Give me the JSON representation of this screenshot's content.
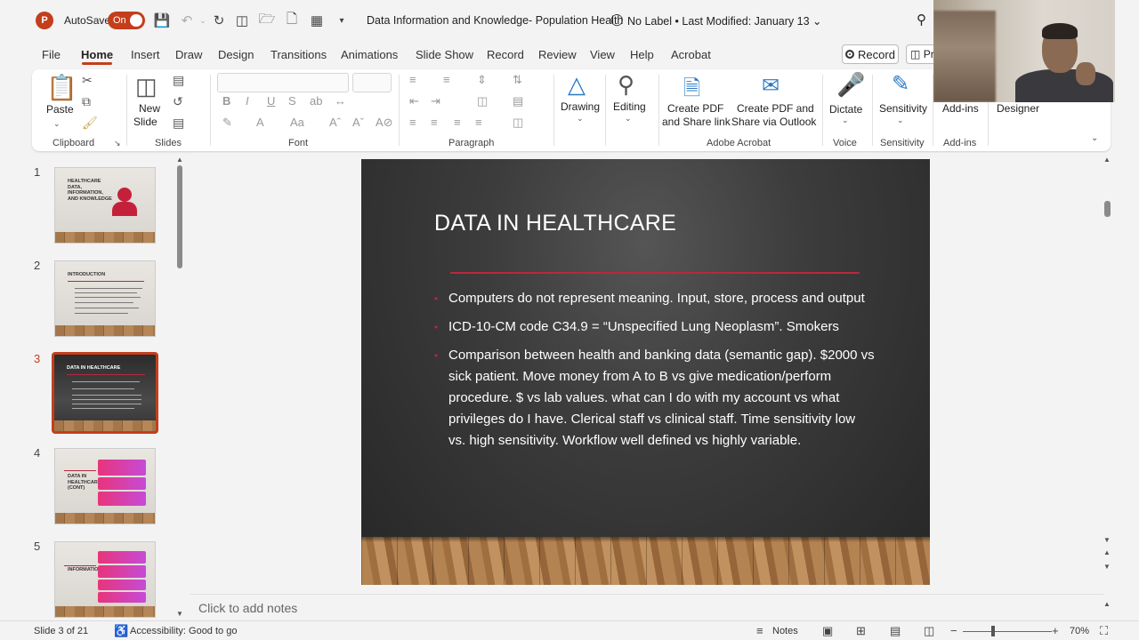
{
  "titlebar": {
    "app_letter": "P",
    "autosave_label": "AutoSave",
    "autosave_state": "On",
    "document_title": "Data Information and Knowledge- Population Health",
    "sensitivity_label": "No Label",
    "last_modified": "•  Last Modified: January 13"
  },
  "menu": {
    "items": [
      "File",
      "Home",
      "Insert",
      "Draw",
      "Design",
      "Transitions",
      "Animations",
      "Slide Show",
      "Record",
      "Review",
      "View",
      "Help",
      "Acrobat"
    ],
    "active": "Home",
    "record_label": "Record",
    "present_label": "Pr"
  },
  "ribbon": {
    "clipboard": {
      "paste": "Paste",
      "group": "Clipboard"
    },
    "slides": {
      "new_slide": "New",
      "new_slide2": "Slide",
      "group": "Slides"
    },
    "font": {
      "group": "Font"
    },
    "paragraph": {
      "group": "Paragraph"
    },
    "drawing": {
      "label": "Drawing"
    },
    "editing": {
      "label": "Editing"
    },
    "acrobat": {
      "create_pdf_link": "Create PDF",
      "create_pdf_link2": "and Share link",
      "create_pdf_outlook": "Create PDF and",
      "create_pdf_outlook2": "Share via Outlook",
      "group": "Adobe Acrobat"
    },
    "voice": {
      "dictate": "Dictate",
      "group": "Voice"
    },
    "sensitivity": {
      "label": "Sensitivity",
      "group": "Sensitivity"
    },
    "addins": {
      "label": "Add-ins",
      "group": "Add-ins"
    },
    "designer": {
      "label": "Designer"
    }
  },
  "thumbnails": [
    {
      "number": "1",
      "title": "HEALTHCARE DATA, INFORMATION, AND KNOWLEDGE"
    },
    {
      "number": "2",
      "title": "INTRODUCTION"
    },
    {
      "number": "3",
      "title": "DATA IN HEALTHCARE"
    },
    {
      "number": "4",
      "title": "DATA IN HEALTHCARE (CONT)"
    },
    {
      "number": "5",
      "title": "INFORMATION"
    }
  ],
  "slide": {
    "title": "DATA IN HEALTHCARE",
    "bullets": [
      "Computers do not represent meaning. Input, store, process and output",
      "ICD-10-CM code C34.9 = “Unspecified Lung Neoplasm”. Smokers",
      "Comparison between health and banking data (semantic gap). $2000 vs sick patient. Move money from A to B vs give medication/perform procedure. $ vs lab values. what can I do with my account vs what privileges do I have. Clerical staff vs clinical staff. Time sensitivity low vs. high sensitivity. Workflow well defined vs highly variable."
    ]
  },
  "notes": {
    "placeholder": "Click to add notes"
  },
  "status": {
    "slide_counter": "Slide 3 of 21",
    "accessibility": "Accessibility: Good to go",
    "notes_label": "Notes",
    "zoom": "70%"
  },
  "colors": {
    "accent": "#c43e1c",
    "slide_rule": "#b8283c"
  }
}
